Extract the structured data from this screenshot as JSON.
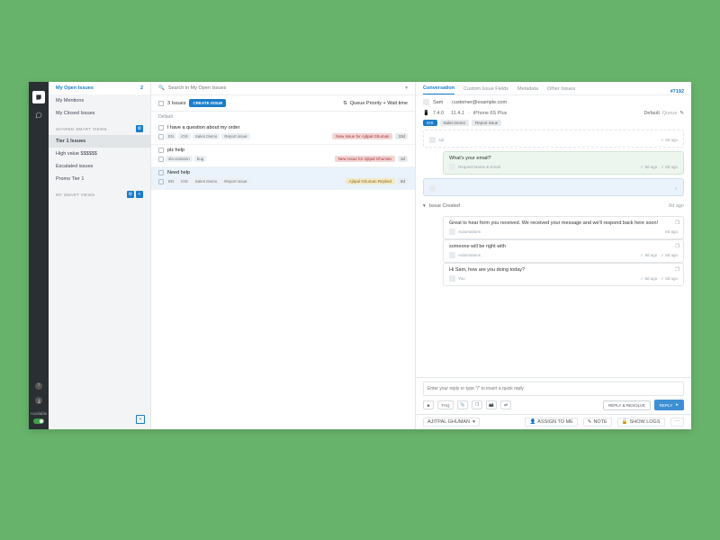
{
  "rail": {
    "available_label": "Available"
  },
  "sidebar": {
    "fixed": [
      {
        "label": "My Open Issues",
        "count": "2",
        "selected": true
      },
      {
        "label": "My Mentions"
      },
      {
        "label": "My Closed Issues"
      }
    ],
    "shared_header": "SHARED SMART VIEWS",
    "shared": [
      {
        "label": "Tier 1 Issues",
        "active": true
      },
      {
        "label": "High value $$$$$$"
      },
      {
        "label": "Escalated issues"
      },
      {
        "label": "Promo Tier 1"
      }
    ],
    "my_header": "MY SMART VIEWS"
  },
  "search": {
    "placeholder": "Search in My Open Issues"
  },
  "listbar": {
    "count": "3 Issues",
    "create": "CREATE ISSUE",
    "sort": "Queue Priority + Wait time"
  },
  "group": "Default",
  "issues": [
    {
      "title": "I have a question about my order",
      "tags": [
        "EN",
        "iOS",
        "Sales Demo",
        "Report issue"
      ],
      "status": "New Issue for Ajitpal Ghuman",
      "pill": "red",
      "age": "33d"
    },
    {
      "title": "plz help",
      "tags": [
        "sla-violation",
        "bug"
      ],
      "status": "New Issue for Ajitpal Ghuman",
      "pill": "red",
      "age": "3d"
    },
    {
      "title": "Need help",
      "tags": [
        "EN",
        "iOS",
        "Sales Demo",
        "Report issue"
      ],
      "status": "Ajitpal Ghuman Replied",
      "pill": "yel",
      "age": "8d",
      "selected": true
    }
  ],
  "detail": {
    "tabs": [
      "Conversation",
      "Custom Issue Fields",
      "Metadata",
      "Other Issues"
    ],
    "id": "#7192",
    "user": "Sam",
    "email": "customer@example.com",
    "meta": {
      "ver1": "7.4.0",
      "ver2": "11.4.1",
      "device": "iPhone 6S Plus",
      "priority_label": "Default",
      "priority_value": "Queue"
    },
    "chips": [
      "iOS",
      "Sales Demo",
      "Report issue"
    ],
    "first": {
      "who": "Ajit",
      "time": "8d ago"
    },
    "prompt": {
      "text": "What's your email?",
      "who": "Request Name & Email",
      "t1": "8d ago",
      "t2": "8d ago"
    },
    "reply": "REPLY",
    "collapser": {
      "label": "Issue Created",
      "time": "8d ago"
    },
    "messages": [
      {
        "text": "Great to hear form you received. We received your message and we'll respond back here soon!",
        "who": "Automations",
        "time": "8d ago"
      },
      {
        "text": "someone will be right with",
        "who": "Automations",
        "t1": "8d ago",
        "t2": "8d ago"
      },
      {
        "text": "Hi Sam, how are you doing today?",
        "who": "You",
        "t1": "8d ago",
        "t2": "8d ago"
      }
    ],
    "composer_placeholder": "Enter your reply or type \"/\" to insert a quick reply",
    "faq": "FAQ",
    "reply_resolve": "REPLY & RESOLVE",
    "assignee": "AJITPAL GHUMAN",
    "assign_me": "ASSIGN TO ME",
    "note": "NOTE",
    "logs": "SHOW LOGS"
  }
}
